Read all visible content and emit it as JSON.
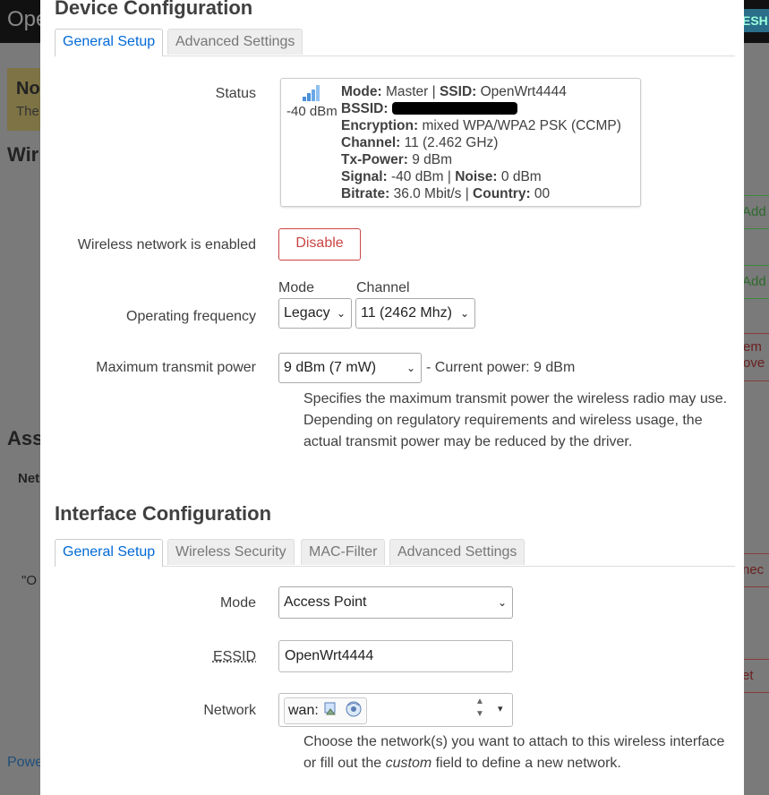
{
  "background": {
    "brand": "Ope",
    "refresh": "ESH",
    "notice_title": "No",
    "notice_text": "The",
    "section_wir": "Wir",
    "section_ass": "Ass",
    "table_net": "Net",
    "row_quote": "\"O",
    "btn_add1": "Add",
    "btn_add2": "Add",
    "btn_remove1": "em",
    "btn_remove2": "ove",
    "btn_connect": "nec",
    "btn_reset": "et",
    "footer": "Powe"
  },
  "device": {
    "title": "Device Configuration",
    "tabs": [
      "General Setup",
      "Advanced Settings"
    ],
    "status_label": "Status",
    "signal_dbm": "-40 dBm",
    "status": {
      "mode_label": "Mode:",
      "mode": "Master",
      "ssid_label": "SSID:",
      "ssid": "OpenWrt4444",
      "bssid_label": "BSSID:",
      "encryption_label": "Encryption:",
      "encryption": "mixed WPA/WPA2 PSK (CCMP)",
      "channel_label": "Channel:",
      "channel": "11 (2.462 GHz)",
      "txpower_label": "Tx-Power:",
      "txpower": "9 dBm",
      "signal_label": "Signal:",
      "signal": "-40 dBm",
      "noise_label": "Noise:",
      "noise": "0 dBm",
      "bitrate_label": "Bitrate:",
      "bitrate": "36.0 Mbit/s",
      "country_label": "Country:",
      "country": "00"
    },
    "enabled_label": "Wireless network is enabled",
    "disable_button": "Disable",
    "freq_label": "Operating frequency",
    "mode_caption": "Mode",
    "channel_caption": "Channel",
    "mode_value": "Legacy",
    "channel_value": "11 (2462 Mhz)",
    "txpower_label": "Maximum transmit power",
    "txpower_value": "9 dBm (7 mW)",
    "current_power": "- Current power: 9 dBm",
    "txpower_help": "Specifies the maximum transmit power the wireless radio may use. Depending on regulatory requirements and wireless usage, the actual transmit power may be reduced by the driver."
  },
  "iface": {
    "title": "Interface Configuration",
    "tabs": [
      "General Setup",
      "Wireless Security",
      "MAC-Filter",
      "Advanced Settings"
    ],
    "mode_label": "Mode",
    "mode_value": "Access Point",
    "essid_label": "ESSID",
    "essid_value": "OpenWrt4444",
    "network_label": "Network",
    "network_value": "wan:",
    "network_help_1": "Choose the network(s) you want to attach to this wireless interface or fill out the",
    "network_help_em": "custom",
    "network_help_2": "field to define a new network."
  },
  "colors": {
    "accent": "#0069d6",
    "danger": "#cc4444"
  }
}
